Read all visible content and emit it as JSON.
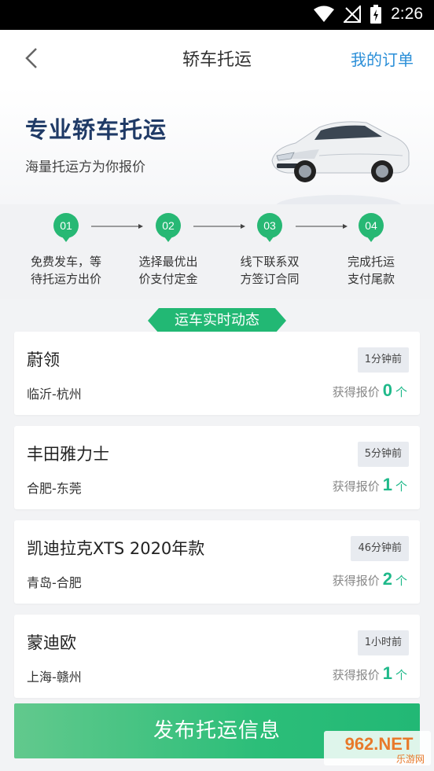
{
  "status_bar": {
    "time": "2:26"
  },
  "header": {
    "title": "轿车托运",
    "right_link": "我的订单"
  },
  "hero": {
    "title": "专业轿车托运",
    "subtitle": "海量托运方为你报价"
  },
  "steps": [
    {
      "num": "01",
      "line1": "免费发车，等",
      "line2": "待托运方出价"
    },
    {
      "num": "02",
      "line1": "选择最优出",
      "line2": "价支付定金"
    },
    {
      "num": "03",
      "line1": "线下联系双",
      "line2": "方签订合同"
    },
    {
      "num": "04",
      "line1": "完成托运",
      "line2": "支付尾款"
    }
  ],
  "realtime": {
    "title": "运车实时动态",
    "items": [
      {
        "car": "蔚领",
        "time": "1分钟前",
        "route": "临沂-杭州",
        "quote_label": "获得报价",
        "count": "0",
        "unit": "个"
      },
      {
        "car": "丰田雅力士",
        "time": "5分钟前",
        "route": "合肥-东莞",
        "quote_label": "获得报价",
        "count": "1",
        "unit": "个"
      },
      {
        "car": "凯迪拉克XTS 2020年款",
        "time": "46分钟前",
        "route": "青岛-合肥",
        "quote_label": "获得报价",
        "count": "2",
        "unit": "个"
      },
      {
        "car": "蒙迪欧",
        "time": "1小时前",
        "route": "上海-赣州",
        "quote_label": "获得报价",
        "count": "1",
        "unit": "个"
      }
    ]
  },
  "publish_button": "发布托运信息",
  "watermark": {
    "main": "962.NET",
    "sub": "乐游网"
  },
  "colors": {
    "accent_green": "#1fb98a",
    "link_blue": "#2b8fd8",
    "title_navy": "#1f3a66"
  }
}
